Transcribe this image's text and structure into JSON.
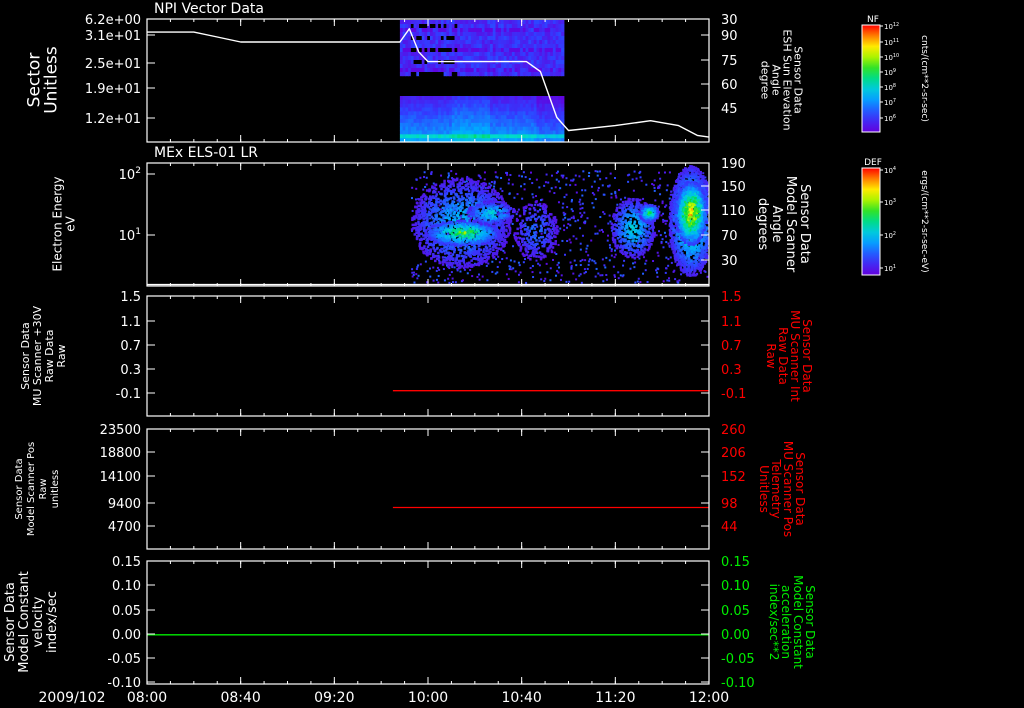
{
  "chart_data": [
    {
      "type": "heatmap",
      "title": "NPI Vector Data",
      "ylabel": [
        "Sector",
        "Unitless"
      ],
      "yticks": [
        "3.1e+01",
        "2.5e+01",
        "1.9e+01",
        "1.2e+01",
        "6.2e+00"
      ],
      "ylabel_right": [
        "Sensor Data",
        "ESH Sun Elevation",
        "Angle",
        "degree"
      ],
      "yticks_right": [
        "90",
        "75",
        "60",
        "45",
        "30"
      ],
      "ylim_right": [
        15,
        90
      ],
      "data_time_range": [
        "09:48",
        "10:58"
      ],
      "overlay_line": {
        "axis": "right",
        "points": [
          [
            "08:00",
            82
          ],
          [
            "08:20",
            82
          ],
          [
            "08:30",
            79
          ],
          [
            "08:40",
            76
          ],
          [
            "09:00",
            76
          ],
          [
            "09:20",
            76
          ],
          [
            "09:48",
            76
          ],
          [
            "09:52",
            84
          ],
          [
            "09:56",
            70
          ],
          [
            "10:00",
            64
          ],
          [
            "10:20",
            64
          ],
          [
            "10:42",
            64
          ],
          [
            "10:48",
            58
          ],
          [
            "10:55",
            30
          ],
          [
            "11:00",
            22
          ],
          [
            "11:20",
            25
          ],
          [
            "11:35",
            28
          ],
          [
            "11:47",
            25
          ],
          [
            "11:55",
            19
          ],
          [
            "12:00",
            18
          ]
        ]
      },
      "colorbar": {
        "label": "NF",
        "units": "cnts/(cm**2-sr-sec)",
        "ticks": [
          "10^12",
          "10^11",
          "10^10",
          "10^9",
          "10^8",
          "10^7",
          "10^6"
        ]
      }
    },
    {
      "type": "heatmap",
      "title": "MEx ELS-01 LR",
      "ylabel": [
        "Electron Energy",
        "eV"
      ],
      "yticks": [
        "10^2",
        "10^1"
      ],
      "yscale": "log",
      "ylabel_right": [
        "Sensor Data",
        "Model Scanner",
        "Angle",
        "degrees"
      ],
      "yticks_right": [
        "190",
        "150",
        "110",
        "70",
        "30"
      ],
      "ylim_right": [
        10,
        190
      ],
      "overlay_line": {
        "axis": "right",
        "points": [
          [
            "08:00",
            12
          ],
          [
            "12:00",
            12
          ]
        ]
      },
      "colorbar": {
        "label": "DEF",
        "units": "ergs/(cm**2-sr-sec-eV)",
        "ticks": [
          "10^4",
          "10^3",
          "10^2",
          "10^1"
        ]
      }
    },
    {
      "type": "line",
      "ylabel": [
        "Sensor Data",
        "MU Scanner +30V",
        "Raw Data",
        "Raw"
      ],
      "yticks": [
        "1.5",
        "1.1",
        "0.7",
        "0.3",
        "-0.1"
      ],
      "ylim": [
        -0.4,
        1.5
      ],
      "ylabel_right": [
        "Sensor Data",
        "MU Scanner Int",
        "Raw Data",
        "Raw"
      ],
      "yticks_right": [
        "1.5",
        "1.1",
        "0.7",
        "0.3",
        "-0.1"
      ],
      "series": [
        {
          "axis": "right",
          "color": "#ff0000",
          "x": [
            "09:45",
            "12:00"
          ],
          "values": [
            0.0,
            0.0
          ]
        }
      ]
    },
    {
      "type": "line",
      "ylabel": [
        "Sensor Data",
        "Model Scanner Pos",
        "Raw",
        "unitless"
      ],
      "yticks": [
        "23500",
        "18800",
        "14100",
        "9400",
        "4700"
      ],
      "ylim": [
        0,
        23500
      ],
      "ylabel_right": [
        "Sensor Data",
        "MU Scanner Pos",
        "Telemetry",
        "Unitless"
      ],
      "yticks_right": [
        "260",
        "206",
        "152",
        "98",
        "44"
      ],
      "ylim_right": [
        0,
        260
      ],
      "series": [
        {
          "axis": "right",
          "color": "#ff0000",
          "x": [
            "09:45",
            "12:00"
          ],
          "values": [
            90,
            90
          ]
        }
      ]
    },
    {
      "type": "line",
      "ylabel": [
        "Sensor Data",
        "Model Constant",
        "velocity",
        "index/sec"
      ],
      "yticks": [
        "0.15",
        "0.10",
        "0.05",
        "0.00",
        "-0.05",
        "-0.10"
      ],
      "ylim": [
        -0.1,
        0.15
      ],
      "ylabel_right": [
        "Sensor Data",
        "Model Constant",
        "acceleration",
        "index/sec**2"
      ],
      "yticks_right": [
        "0.15",
        "0.10",
        "0.05",
        "0.00",
        "-0.05",
        "-0.10"
      ],
      "series": [
        {
          "axis": "left",
          "color": "#00ee00",
          "x": [
            "08:00",
            "12:00"
          ],
          "values": [
            0.0,
            0.0
          ]
        }
      ]
    }
  ],
  "xaxis": {
    "date": "2009/102",
    "ticks": [
      "08:00",
      "08:40",
      "09:20",
      "10:00",
      "10:40",
      "11:20",
      "12:00"
    ],
    "range": [
      "08:00",
      "12:00"
    ]
  },
  "colors": {
    "background": "#000000",
    "axes": "#ffffff",
    "red_axis": "#ff0000",
    "green_axis": "#00ee00"
  }
}
